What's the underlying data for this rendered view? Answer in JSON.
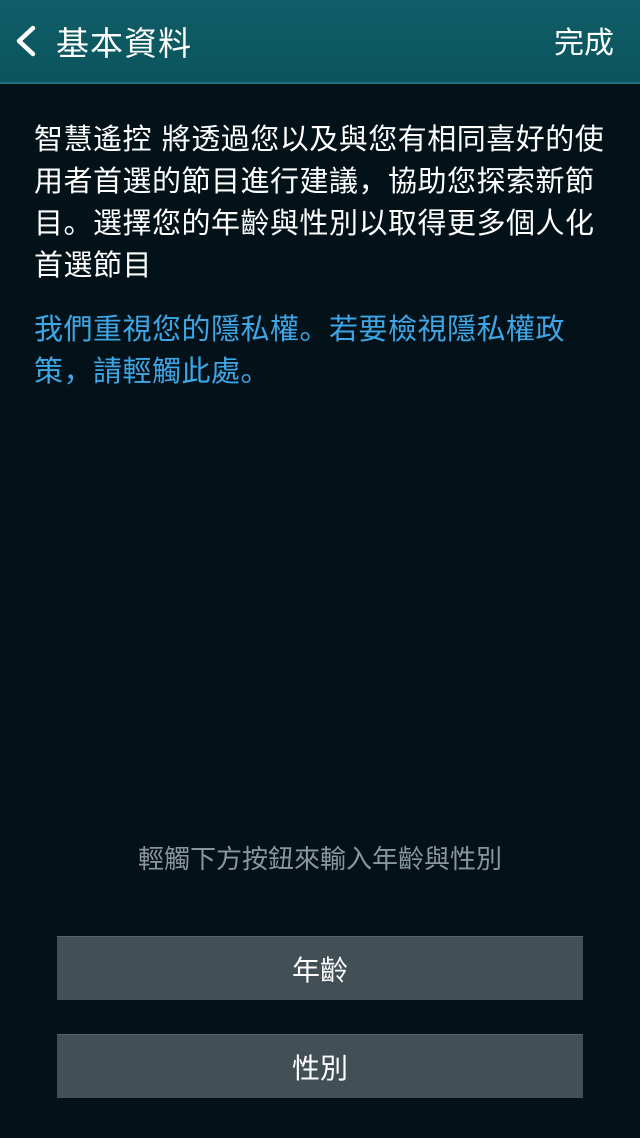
{
  "header": {
    "back_icon": "chevron-left-icon",
    "title": "基本資料",
    "done_label": "完成"
  },
  "main": {
    "description": "智慧遙控 將透過您以及與您有相同喜好的使用者首選的節目進行建議，協助您探索新節目。選擇您的年齡與性別以取得更多個人化首選節目",
    "privacy_link": "我們重視您的隱私權。若要檢視隱私權政策，請輕觸此處。",
    "instruction": "輕觸下方按鈕來輸入年齡與性別",
    "age_button": "年齡",
    "gender_button": "性別"
  },
  "colors": {
    "header_bg": "#0b545d",
    "page_bg": "#031219",
    "link": "#3ea6e6",
    "button_bg": "#424f55",
    "instruction_text": "#8c969a"
  }
}
